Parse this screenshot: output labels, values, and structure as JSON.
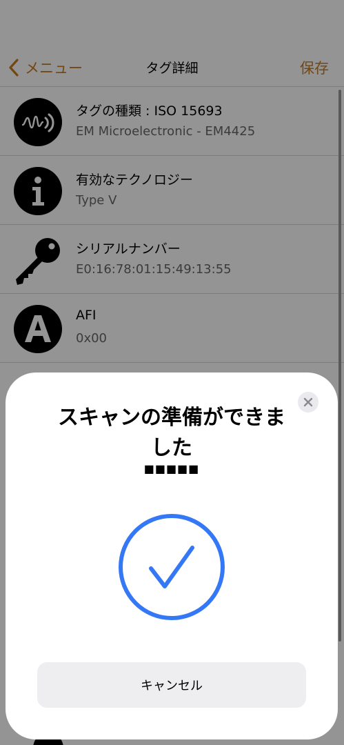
{
  "colors": {
    "accent": "#c97b1f",
    "check": "#3478f6"
  },
  "nav": {
    "back_label": "メニュー",
    "title": "タグ詳細",
    "save_label": "保存"
  },
  "list": [
    {
      "icon": "nfc-signal-icon",
      "title": "タグの種類 : ISO 15693",
      "sub": "EM Microelectronic - EM4425"
    },
    {
      "icon": "info-icon",
      "title": "有効なテクノロジー",
      "sub": "Type V"
    },
    {
      "icon": "key-icon",
      "title": "シリアルナンバー",
      "sub": "E0:16:78:01:15:49:13:55"
    },
    {
      "icon": "letter-a-icon",
      "title": "AFI",
      "sub": "0x00"
    }
  ],
  "sheet": {
    "title": "スキャンの準備ができました",
    "subtitle": "■■■■■",
    "cancel_label": "キャンセル",
    "status_icon": "checkmark-circle-icon"
  }
}
